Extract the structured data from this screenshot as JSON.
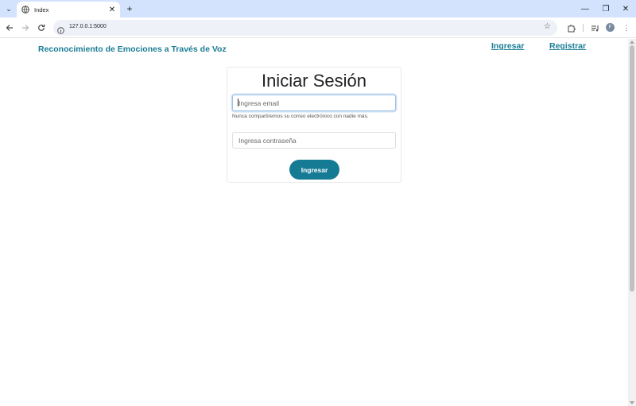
{
  "browser": {
    "tab_title": "Index",
    "tab_close": "✕",
    "new_tab": "+",
    "url": "127.0.0.1:5000",
    "window_controls": {
      "minimize": "—",
      "restore": "❐",
      "close": "✕"
    },
    "profile_initial": "F",
    "icons": [
      "tab-search-icon",
      "globe-icon",
      "back-icon",
      "forward-icon",
      "reload-icon",
      "site-info-icon",
      "bookmark-star-icon",
      "extensions-icon",
      "media-control-icon",
      "menu-icon"
    ]
  },
  "page": {
    "brand": "Reconocimiento de Emociones a Través de Voz",
    "nav": {
      "login": "Ingresar",
      "register": "Registrar"
    },
    "form": {
      "title": "Iniciar Sesión",
      "email_placeholder": "Ingresa email",
      "email_help": "Nunca compartiremos su correo electrónico con nadie más.",
      "password_placeholder": "Ingresa contraseña",
      "submit": "Ingresar"
    },
    "colors": {
      "accent": "#1a7d96",
      "button": "#157a94",
      "tabstrip": "#d3e3fd"
    }
  }
}
